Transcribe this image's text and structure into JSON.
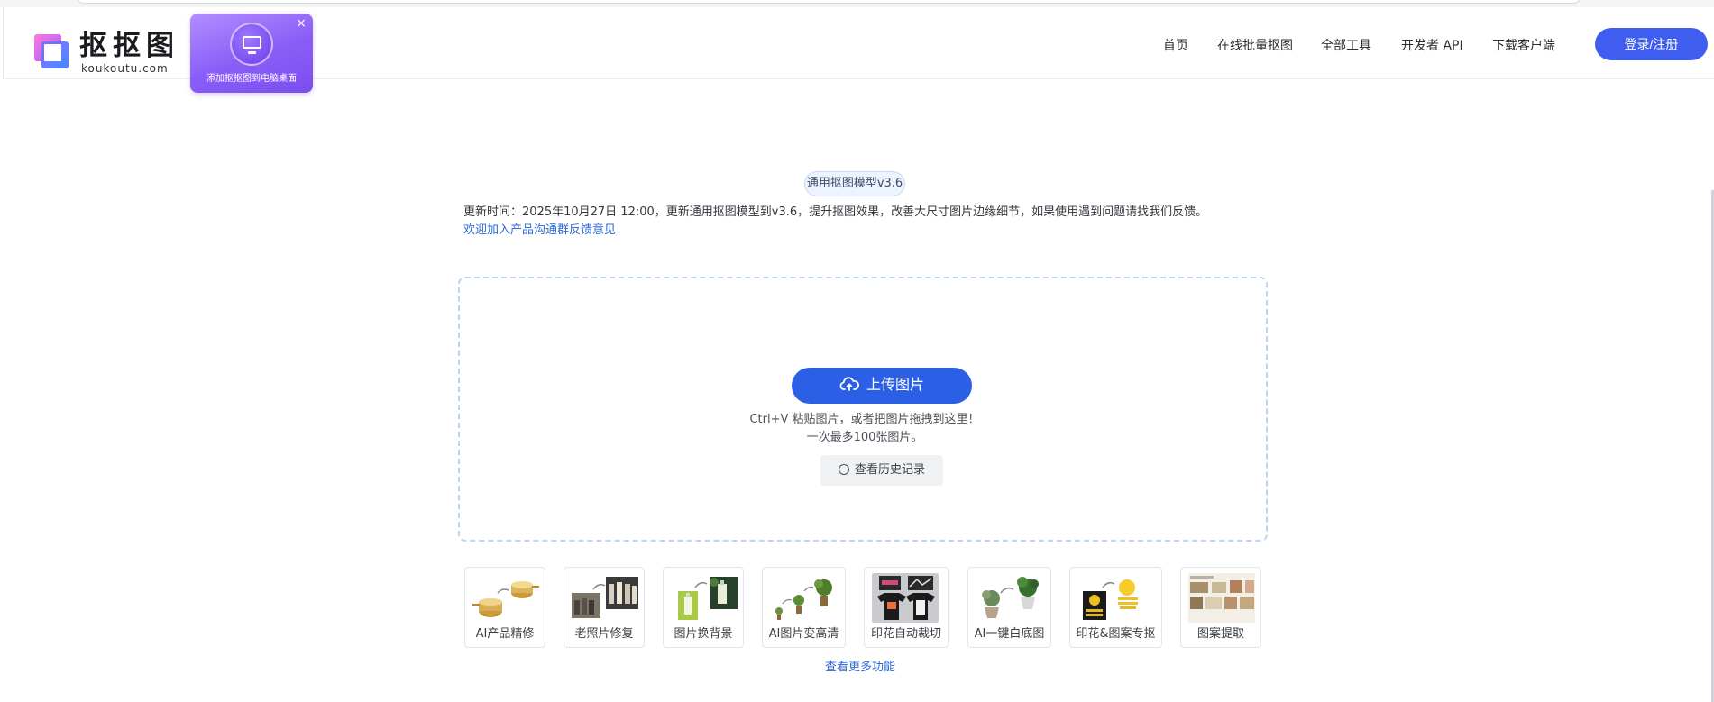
{
  "header": {
    "logo_title": "抠抠图",
    "logo_domain": "koukoutu.com",
    "promo_text": "添加抠抠图到电脑桌面",
    "promo_close": "×",
    "nav": [
      {
        "label": "首页"
      },
      {
        "label": "在线批量抠图"
      },
      {
        "label": "全部工具"
      },
      {
        "label": "开发者 API"
      },
      {
        "label": "下载客户端"
      }
    ],
    "login_label": "登录/注册"
  },
  "main": {
    "model_tag": "通用抠图模型v3.6",
    "update_note": "更新时间：2025年10月27日 12:00，更新通用抠图模型到v3.6，提升抠图效果，改善大尺寸图片边缘细节，如果使用遇到问题请找我们反馈。",
    "feedback_link": "欢迎加入产品沟通群反馈意见",
    "upload_label": "上传图片",
    "hint_line1": "Ctrl+V 粘贴图片，或者把图片拖拽到这里！",
    "hint_line2": "一次最多100张图片。",
    "history_label": "查看历史记录"
  },
  "tools": [
    {
      "label": "AI产品精修"
    },
    {
      "label": "老照片修复"
    },
    {
      "label": "图片换背景"
    },
    {
      "label": "AI图片变高清"
    },
    {
      "label": "印花自动裁切"
    },
    {
      "label": "AI一键白底图"
    },
    {
      "label": "印花&图案专抠"
    },
    {
      "label": "图案提取"
    }
  ],
  "more_tools_link": "查看更多功能",
  "colors": {
    "primary": "#2a5fe6",
    "login": "#3f5ef0",
    "link": "#2d6bd8",
    "promo": "#8a5cf7"
  }
}
